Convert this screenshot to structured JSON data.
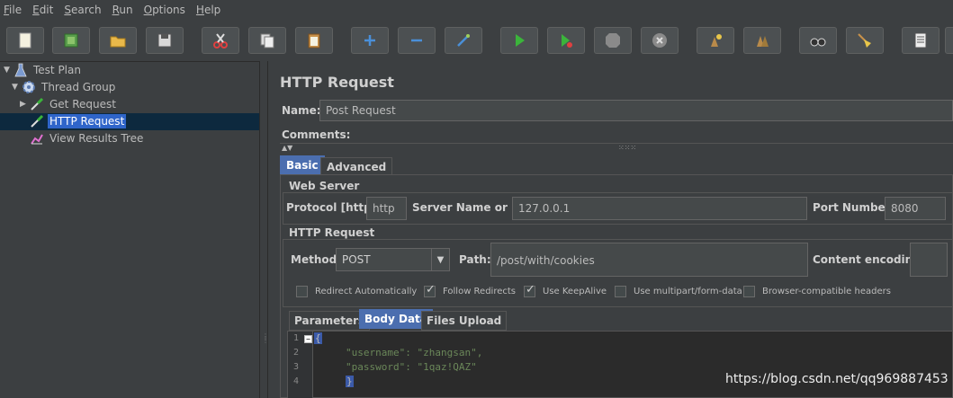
{
  "menu": [
    {
      "mn": "F",
      "rest": "ile"
    },
    {
      "mn": "E",
      "rest": "dit"
    },
    {
      "mn": "S",
      "rest": "earch"
    },
    {
      "mn": "R",
      "rest": "un"
    },
    {
      "mn": "O",
      "rest": "ptions"
    },
    {
      "mn": "H",
      "rest": "elp"
    }
  ],
  "tree": {
    "test_plan": "Test Plan",
    "thread_group": "Thread Group",
    "get_request": "Get Request",
    "http_request": "HTTP Request",
    "view_results_tree": "View Results Tree"
  },
  "panel": {
    "title": "HTTP Request",
    "name_label": "Name:",
    "name_value": "Post Request",
    "comments_label": "Comments:"
  },
  "tabs": {
    "basic": "Basic",
    "advanced": "Advanced"
  },
  "web_server": {
    "title": "Web Server",
    "protocol_label": "Protocol [http]:",
    "protocol_value": "http",
    "server_label": "Server Name or IP:",
    "server_value": "127.0.0.1",
    "port_label": "Port Number:",
    "port_value": "8080"
  },
  "http_request": {
    "title": "HTTP Request",
    "method_label": "Method:",
    "method_value": "POST",
    "path_label": "Path:",
    "path_value": "/post/with/cookies",
    "encoding_label": "Content encoding:",
    "encoding_value": ""
  },
  "checkboxes": [
    {
      "label": "Redirect Automatically",
      "checked": false
    },
    {
      "label": "Follow Redirects",
      "checked": true
    },
    {
      "label": "Use KeepAlive",
      "checked": true
    },
    {
      "label": "Use multipart/form-data",
      "checked": false
    },
    {
      "label": "Browser-compatible headers",
      "checked": false
    }
  ],
  "subtabs": {
    "parameters": "Parameters",
    "body_data": "Body Data",
    "files_upload": "Files Upload"
  },
  "editor": {
    "line_numbers": [
      "1",
      "2",
      "3",
      "4"
    ],
    "open_brace": "{",
    "line2": "\"username\": \"zhangsan\",",
    "line3": "\"password\": \"1qaz!QAZ\"",
    "close_brace": "}"
  },
  "watermark": "https://blog.csdn.net/qq969887453"
}
